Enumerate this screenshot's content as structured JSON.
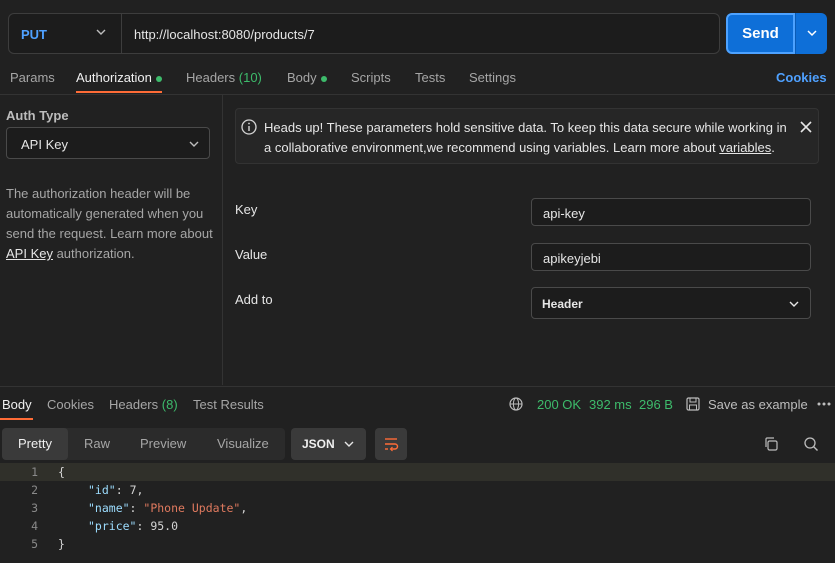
{
  "request": {
    "method": "PUT",
    "url": "http://localhost:8080/products/7",
    "send_label": "Send"
  },
  "req_tabs": {
    "params": "Params",
    "authorization": "Authorization",
    "headers": "Headers",
    "headers_count": "(10)",
    "body": "Body",
    "scripts": "Scripts",
    "tests": "Tests",
    "settings": "Settings",
    "cookies": "Cookies"
  },
  "auth": {
    "type_label": "Auth Type",
    "type_value": "API Key",
    "desc_1": "The authorization header will be automatically generated when you send the request. Learn more about ",
    "desc_link": "API Key",
    "desc_2": " authorization."
  },
  "banner": {
    "text": "Heads up! These parameters hold sensitive data. To keep this data secure while working in a collaborative environment,we recommend using variables. Learn more about ",
    "link": "variables",
    "end": "."
  },
  "form": {
    "key_label": "Key",
    "key_value": "api-key",
    "value_label": "Value",
    "value_value": "apikeyjebi",
    "addto_label": "Add to",
    "addto_value": "Header"
  },
  "response": {
    "tabs": {
      "body": "Body",
      "cookies": "Cookies",
      "headers": "Headers",
      "headers_count": "(8)",
      "test_results": "Test Results"
    },
    "status": "200 OK",
    "time": "392 ms",
    "size": "296 B",
    "save_example": "Save as example",
    "views": [
      "Pretty",
      "Raw",
      "Preview",
      "Visualize"
    ],
    "format": "JSON"
  },
  "code_lines": [
    {
      "n": "1",
      "t": "{"
    },
    {
      "n": "2",
      "k": "\"id\"",
      "sep": ": ",
      "v": "7",
      "end": ","
    },
    {
      "n": "3",
      "k": "\"name\"",
      "sep": ": ",
      "v": "\"Phone Update\"",
      "end": ","
    },
    {
      "n": "4",
      "k": "\"price\"",
      "sep": ": ",
      "v": "95.0",
      "end": ""
    },
    {
      "n": "5",
      "t": "}"
    }
  ],
  "colors": {
    "accent_blue": "#0e6fd8",
    "tab_underline": "#ff6c37",
    "status_green": "#3dbb6b"
  }
}
